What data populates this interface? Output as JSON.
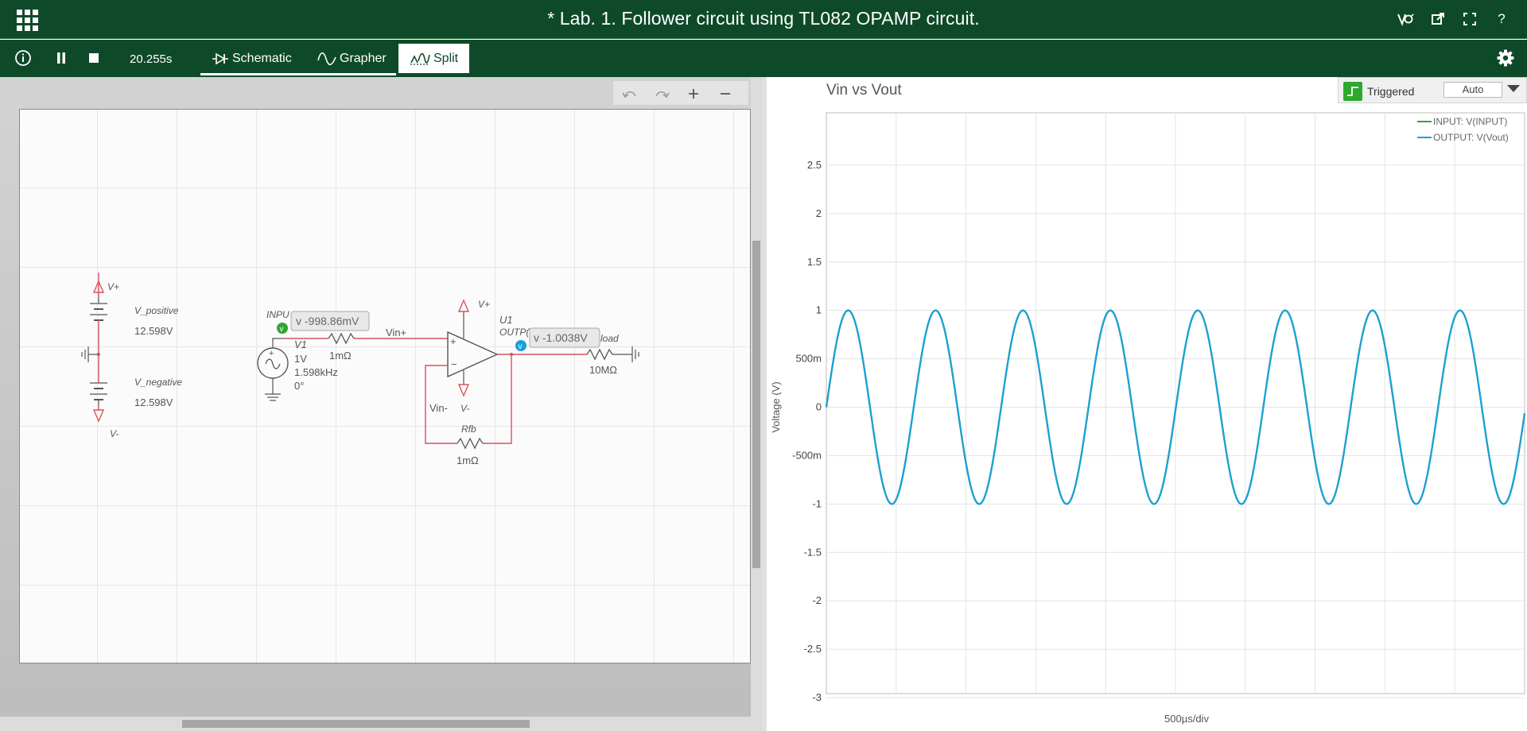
{
  "window": {
    "title": "* Lab. 1. Follower circuit using TL082 OPAMP circuit.",
    "icons": [
      "apps-grid-icon",
      "spice-icon",
      "share-icon",
      "fullscreen-icon",
      "help-icon"
    ],
    "help_label": "?"
  },
  "toolbar": {
    "time": "20.255s",
    "tabs": [
      {
        "label": "Schematic",
        "icon": "diode-icon",
        "active": false
      },
      {
        "label": "Grapher",
        "icon": "sine-icon",
        "active": false
      },
      {
        "label": "Split",
        "icon": "split-icon",
        "active": true
      }
    ],
    "icons": [
      "info-icon",
      "pause-icon",
      "stop-icon",
      "gear-icon"
    ]
  },
  "schematic": {
    "labels": {
      "vpos_rail": "V+",
      "vpos_name": "V_positive",
      "vpos_value": "12.598V",
      "vneg_name": "V_negative",
      "vneg_value": "12.598V",
      "vneg_rail": "V-",
      "input_label": "INPU",
      "probe_in_value": "v -998.86mV",
      "source_name": "V1",
      "source_amp": "1V",
      "source_freq": "1.598kHz",
      "source_phase": "0°",
      "r1_value": "1mΩ",
      "net_vin_plus": "Vin+",
      "opamp_vpos": "V+",
      "opamp_name": "U1",
      "output_label": "OUTP(",
      "probe_out_value": "v -1.0038V",
      "load_label": "load",
      "load_value": "10MΩ",
      "opamp_vneg": "V-",
      "net_vin_minus": "Vin-",
      "rfb_name": "Rfb",
      "rfb_value": "1mΩ",
      "plus_sign": "+",
      "minus_sign": "−",
      "probe_marker": "v"
    },
    "colors": {
      "wire": "#d9525e",
      "component": "#555555",
      "probe_green": "#2ea82e",
      "probe_blue": "#1a9fd9"
    }
  },
  "grapher": {
    "trigger_label": "Triggered",
    "trigger_mode": "Auto"
  },
  "chart_data": {
    "type": "line",
    "title": "Vin vs Vout",
    "xlabel": "500µs/div",
    "ylabel": "Voltage (V)",
    "ylim": [
      -3,
      3
    ],
    "yticks": [
      "2.5",
      "2",
      "1.5",
      "1",
      "500m",
      "0",
      "-500m",
      "-1",
      "-1.5",
      "-2",
      "-2.5",
      "-3"
    ],
    "ytick_values": [
      2.5,
      2,
      1.5,
      1,
      0.5,
      0,
      -0.5,
      -1,
      -1.5,
      -2,
      -2.5,
      -3
    ],
    "x_divisions": 10,
    "grid": true,
    "legend_position": "top-right",
    "series": [
      {
        "name": "INPUT: V(INPUT)",
        "color": "#2ea82e",
        "amplitude": 1,
        "frequency_hz": 1598,
        "phase_deg": 0
      },
      {
        "name": "OUTPUT: V(Vout)",
        "color": "#1a9fd9",
        "amplitude": 1,
        "frequency_hz": 1598,
        "phase_deg": 0
      }
    ],
    "x_range_us": [
      0,
      5000
    ]
  }
}
